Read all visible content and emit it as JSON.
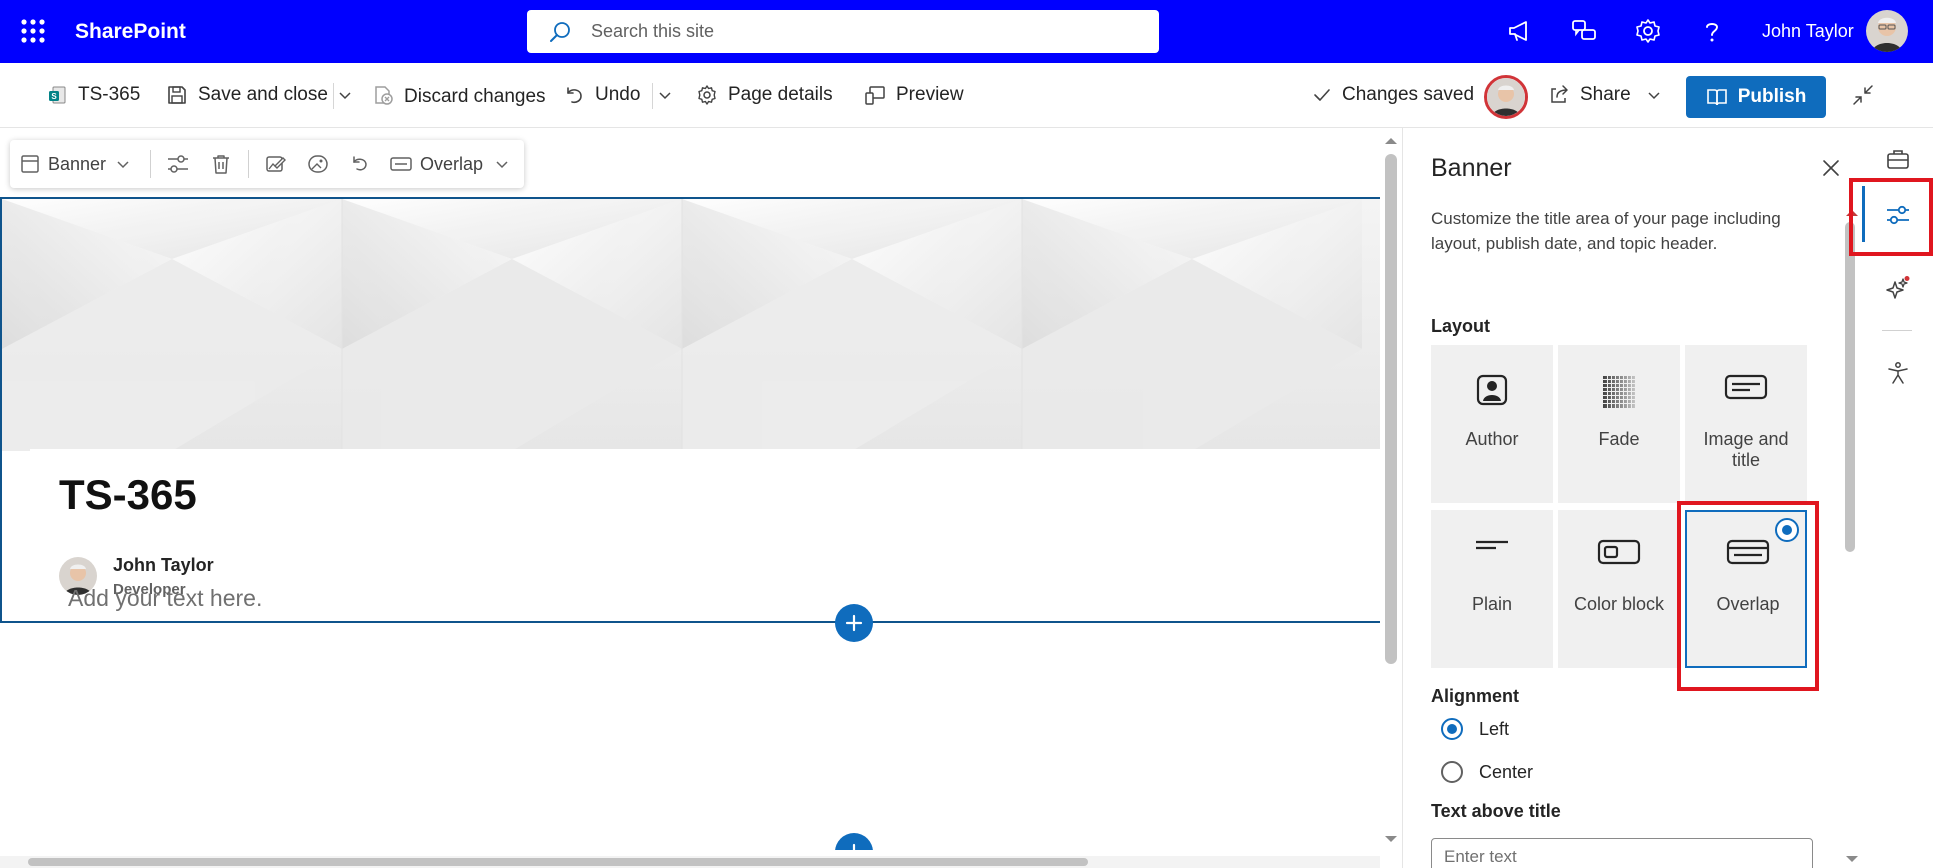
{
  "suite": {
    "brand": "SharePoint",
    "search_placeholder": "Search this site",
    "user_name": "John Taylor",
    "icons": [
      "app-launcher-icon",
      "megaphone-icon",
      "chat-icon",
      "settings-icon",
      "help-icon"
    ]
  },
  "commandbar": {
    "page_name": "TS-365",
    "save_close": "Save and close",
    "discard": "Discard changes",
    "undo": "Undo",
    "page_details": "Page details",
    "preview": "Preview",
    "status": "Changes saved",
    "share": "Share",
    "publish": "Publish"
  },
  "toolbar": {
    "webpart": "Banner",
    "layout_value": "Overlap"
  },
  "banner": {
    "title": "TS-365",
    "author_name": "John Taylor",
    "author_role": "Developer"
  },
  "canvas": {
    "text_placeholder": "Add your text here."
  },
  "pane": {
    "title": "Banner",
    "description": "Customize the title area of your page including layout, publish date, and topic header.",
    "layout_label": "Layout",
    "layouts": [
      {
        "label": "Author",
        "icon": "author-layout-icon",
        "selected": false
      },
      {
        "label": "Fade",
        "icon": "fade-layout-icon",
        "selected": false
      },
      {
        "label": "Image and title",
        "icon": "image-and-title-layout-icon",
        "selected": false
      },
      {
        "label": "Plain",
        "icon": "plain-layout-icon",
        "selected": false
      },
      {
        "label": "Color block",
        "icon": "color-block-layout-icon",
        "selected": false
      },
      {
        "label": "Overlap",
        "icon": "overlap-layout-icon",
        "selected": true
      }
    ],
    "alignment_label": "Alignment",
    "alignment_options": [
      {
        "label": "Left",
        "selected": true
      },
      {
        "label": "Center",
        "selected": false
      }
    ],
    "text_above_label": "Text above title",
    "text_above_placeholder": "Enter text"
  },
  "rail": {
    "icons": [
      "toolbox-icon",
      "properties-icon",
      "copilot-icon",
      "accessibility-icon"
    ],
    "active": "properties-icon"
  },
  "colors": {
    "suite_bar": "#0000ff",
    "accent": "#0f6cbd",
    "highlight": "#e0161f"
  }
}
